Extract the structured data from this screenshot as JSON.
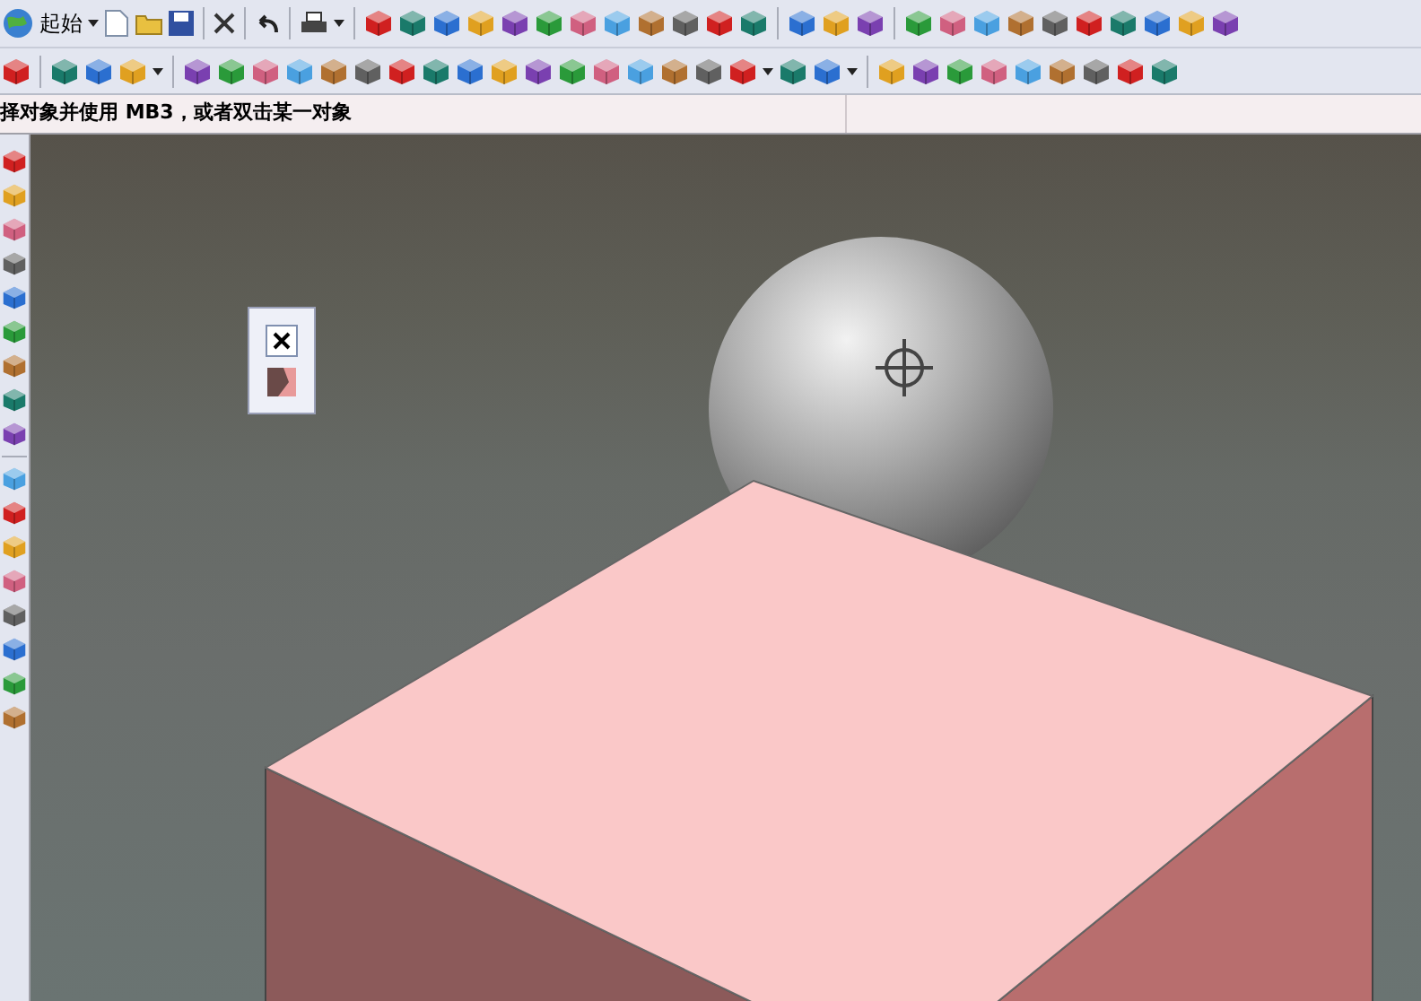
{
  "toolbar": {
    "start_menu": "起始"
  },
  "status_bar": {
    "prompt": "择对象并使用 MB3，或者双击某一对象"
  }
}
